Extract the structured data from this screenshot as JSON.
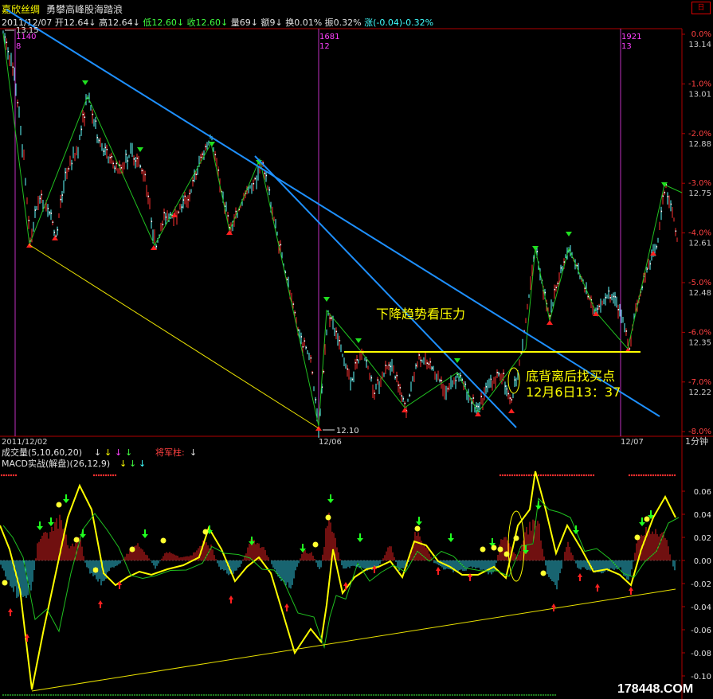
{
  "header": {
    "stock_name": "嘉欣丝绸",
    "subtitle": "勇攀高峰股海踏浪",
    "minimize_label": "日",
    "info": [
      {
        "text": "2011/12/07",
        "color": "#e0e0e0"
      },
      {
        "text": "开12.64↓",
        "color": "#e0e0e0"
      },
      {
        "text": "高12.64↓",
        "color": "#e0e0e0"
      },
      {
        "text": "低12.60↓",
        "color": "#40ff40"
      },
      {
        "text": "收12.60↓",
        "color": "#40ff40"
      },
      {
        "text": "量69↓",
        "color": "#e0e0e0"
      },
      {
        "text": "额9↓",
        "color": "#e0e0e0"
      },
      {
        "text": "换0.01%",
        "color": "#e0e0e0"
      },
      {
        "text": "振0.32%",
        "color": "#e0e0e0"
      },
      {
        "text": "涨(-0.04)-0.32%",
        "color": "#40ffff"
      }
    ]
  },
  "price_chart": {
    "top_label": "13.15",
    "low_label": "12.10",
    "bar_markers": [
      {
        "text": "1140\n8",
        "color": "#ff40ff"
      },
      {
        "text": "1681\n12",
        "color": "#ff40ff"
      },
      {
        "text": "1921\n13",
        "color": "#ff40ff"
      }
    ],
    "annotations": {
      "resistance": "下降趋势看压力",
      "divergence": "底背离后找买点",
      "date_note": "12月6日13：37"
    },
    "y_axis": [
      {
        "pct": "0.0%",
        "price": "13.14"
      },
      {
        "pct": "-1.0%",
        "price": "13.01"
      },
      {
        "pct": "-2.0%",
        "price": "12.88"
      },
      {
        "pct": "-3.0%",
        "price": "12.75"
      },
      {
        "pct": "-4.0%",
        "price": "12.61"
      },
      {
        "pct": "-5.0%",
        "price": "12.48"
      },
      {
        "pct": "-6.0%",
        "price": "12.35"
      },
      {
        "pct": "-7.0%",
        "price": "12.22"
      },
      {
        "pct": "-8.0%",
        "price": ""
      }
    ],
    "x_axis": [
      "2011/12/02",
      "12/06",
      "12/07"
    ],
    "period": "1分钟"
  },
  "indicators": {
    "volume_label": "成交量(5,10,60,20)",
    "volume_arrows": [
      {
        "text": "↓",
        "color": "#e0e0e0"
      },
      {
        "text": "↓",
        "color": "#ffff00"
      },
      {
        "text": "↓",
        "color": "#ff40ff"
      },
      {
        "text": "↓",
        "color": "#40ff40"
      }
    ],
    "general_label": "将军柱:",
    "general_arrow": "↓",
    "macd_label": "MACD实战(解盘)(26,12,9)",
    "macd_arrows": [
      {
        "text": "↓",
        "color": "#ffff00"
      },
      {
        "text": "↓",
        "color": "#40ff40"
      },
      {
        "text": "↓",
        "color": "#40ffff"
      }
    ],
    "macd_axis": [
      "0.06",
      "0.04",
      "0.02",
      "0.00",
      "-0.02",
      "-0.04",
      "-0.06",
      "-0.08",
      "-0.10"
    ]
  },
  "watermark": "178448.COM"
}
